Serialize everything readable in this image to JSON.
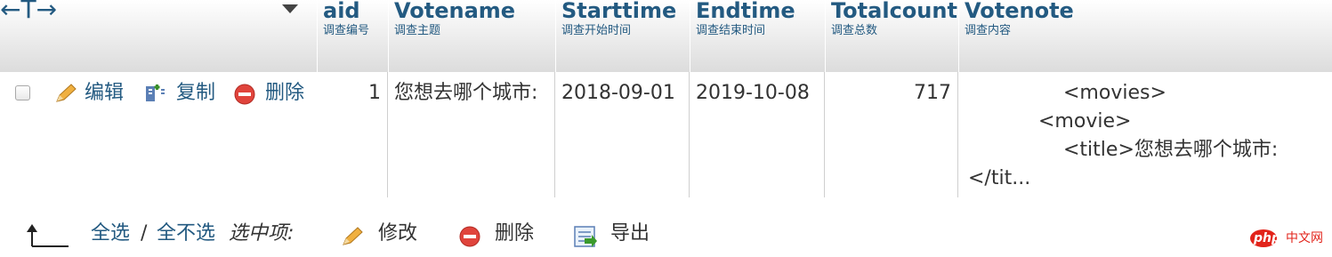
{
  "header": {
    "nav_arrows": "←T→",
    "columns": [
      {
        "name": "aid",
        "comment": "调查编号"
      },
      {
        "name": "Votename",
        "comment": "调查主题"
      },
      {
        "name": "Starttime",
        "comment": "调查开始时间"
      },
      {
        "name": "Endtime",
        "comment": "调查结束时间"
      },
      {
        "name": "Totalcount",
        "comment": "调查总数"
      },
      {
        "name": "Votenote",
        "comment": "调查内容"
      }
    ]
  },
  "row_actions": {
    "edit": "编辑",
    "copy": "复制",
    "delete": "删除"
  },
  "rows": [
    {
      "aid": "1",
      "votename": "您想去哪个城市:",
      "starttime": "2018-09-01",
      "endtime": "2019-10-08",
      "totalcount": "717",
      "votenote_lines": [
        "<movies>",
        "<movie>",
        "<title>您想去哪个城市:",
        "</tit..."
      ]
    }
  ],
  "footer": {
    "select_all": "全选",
    "separator": "/",
    "deselect_all": "全不选",
    "with_selected": "选中项:",
    "edit": "修改",
    "delete": "删除",
    "export": "导出"
  },
  "watermark": "php中文网",
  "colors": {
    "link": "#235a81",
    "delete_icon": "#e0443c",
    "edit_icon": "#e8a23a"
  }
}
